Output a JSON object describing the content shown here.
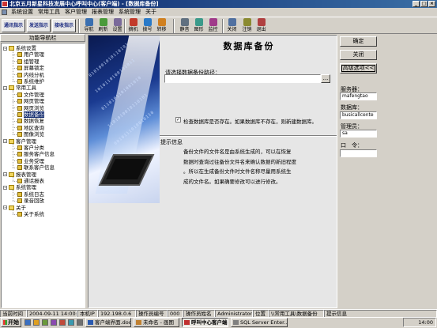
{
  "window": {
    "title": "北京五月新星科技发展中心呼叫中心(客户端) - [数据库备份]",
    "minimize": "_",
    "maximize": "□",
    "close": "×"
  },
  "menu": [
    "系统设置",
    "常用工具",
    "客户管理",
    "报表管理",
    "系统管理",
    "关于"
  ],
  "toolbar": {
    "big_buttons": [
      "通讯指示",
      "发送指示",
      "接收指示"
    ],
    "buttons": [
      {
        "label": "导航",
        "icon": "compass-icon",
        "color": "#3a6fb0"
      },
      {
        "label": "刷新",
        "icon": "refresh-icon",
        "color": "#4a9a3a"
      },
      {
        "label": "设置",
        "icon": "settings-icon",
        "color": "#7a6a9a"
      },
      {
        "label": "摘机",
        "icon": "phone-pickup-icon",
        "color": "#c23a2a"
      },
      {
        "label": "拨号",
        "icon": "dial-icon",
        "color": "#2a7ac8"
      },
      {
        "label": "转移",
        "icon": "transfer-icon",
        "color": "#d08020"
      },
      {
        "label": "静音",
        "icon": "mute-icon",
        "color": "#607080"
      },
      {
        "label": "图形",
        "icon": "chart-icon",
        "color": "#3a9a8a"
      },
      {
        "label": "监控",
        "icon": "monitor-icon",
        "color": "#a03a8a"
      },
      {
        "label": "关闭",
        "icon": "close-icon",
        "color": "#5070a0"
      },
      {
        "label": "注销",
        "icon": "logout-icon",
        "color": "#8a8a30"
      },
      {
        "label": "退出",
        "icon": "exit-icon",
        "color": "#b04040"
      }
    ]
  },
  "nav": {
    "header": "功能导航栏",
    "tree": [
      {
        "label": "系统设置",
        "level": 0,
        "type": "group",
        "expanded": true
      },
      {
        "label": "用户管理",
        "level": 1,
        "type": "item"
      },
      {
        "label": "组管理",
        "level": 1,
        "type": "item"
      },
      {
        "label": "屏幕锁定",
        "level": 1,
        "type": "item"
      },
      {
        "label": "内线分机",
        "level": 1,
        "type": "item"
      },
      {
        "label": "系统维护",
        "level": 1,
        "type": "item"
      },
      {
        "label": "常用工具",
        "level": 0,
        "type": "group",
        "expanded": true
      },
      {
        "label": "文件管理",
        "level": 1,
        "type": "item"
      },
      {
        "label": "网页管理",
        "level": 1,
        "type": "item"
      },
      {
        "label": "网页浏览",
        "level": 1,
        "type": "item"
      },
      {
        "label": "数据备份",
        "level": 1,
        "type": "item",
        "selected": true
      },
      {
        "label": "数据恢复",
        "level": 1,
        "type": "item"
      },
      {
        "label": "地区查询",
        "level": 1,
        "type": "item"
      },
      {
        "label": "图像浏览",
        "level": 1,
        "type": "item"
      },
      {
        "label": "客户管理",
        "level": 0,
        "type": "group",
        "expanded": true
      },
      {
        "label": "客户分类",
        "level": 1,
        "type": "item"
      },
      {
        "label": "服务客户信息",
        "level": 1,
        "type": "item"
      },
      {
        "label": "业务受理",
        "level": 1,
        "type": "item"
      },
      {
        "label": "联系客户信息",
        "level": 1,
        "type": "item"
      },
      {
        "label": "报表管理",
        "level": 0,
        "type": "group",
        "expanded": true
      },
      {
        "label": "通话报表",
        "level": 1,
        "type": "item"
      },
      {
        "label": "系统管理",
        "level": 0,
        "type": "group",
        "expanded": true
      },
      {
        "label": "系统日志",
        "level": 1,
        "type": "item"
      },
      {
        "label": "录音回放",
        "level": 1,
        "type": "item"
      },
      {
        "label": "关于",
        "level": 0,
        "type": "group",
        "expanded": true
      },
      {
        "label": "关于系统",
        "level": 1,
        "type": "item"
      }
    ]
  },
  "main": {
    "title": "数据库备份",
    "path_label": "请选择数据备份路径：",
    "path_value": "",
    "browse_label": "...",
    "check_mark": "✓",
    "check_label": "检查数据库是否存在。如果数据库不存在，则新建数据库。",
    "checked": true,
    "tip_title": "提示信息",
    "tip_lines": [
      "备份文件的文件名是由系统生成的，可以在恢复",
      "数据时查询过往备份文件名来确认数据的新旧程度",
      "。所以在生成备份文件时文件名称尽量用系统生",
      "成的文件名。如果确要修改可以进行修改。"
    ],
    "art_digits": [
      "0101001010110101",
      "1010110100101011",
      "0110101101001010",
      "1101010010110101",
      "0010111010010110"
    ]
  },
  "right": {
    "ok": "确定",
    "close": "关闭",
    "advanced": "高级选项<<",
    "server_label": "服务器：",
    "server_value": "mafengtao",
    "db_label": "数据库：",
    "db_value": "busicallcente",
    "admin_label": "管理员：",
    "admin_value": "sa",
    "pwd_label": "口　令：",
    "pwd_value": ""
  },
  "status": [
    "当前时间",
    "2004-09-11 14:00:54",
    "本机IP",
    "192.198.0.6",
    "操作员编号",
    "000",
    "操作员姓名",
    "Administrator",
    "位置",
    "\\\\常用工具\\数据备份",
    "提示信息"
  ],
  "taskbar": {
    "start": "开始",
    "tasks": [
      {
        "label": "客户端界面.doc ...",
        "active": false,
        "color": "#2a5ab0"
      },
      {
        "label": "未命名 - 画图",
        "active": false,
        "color": "#c08030"
      },
      {
        "label": "呼叫中心客户端",
        "active": true,
        "color": "#c03030"
      },
      {
        "label": "SQL Server Enter...",
        "active": false,
        "color": "#808080"
      }
    ],
    "clock": "14:00"
  }
}
